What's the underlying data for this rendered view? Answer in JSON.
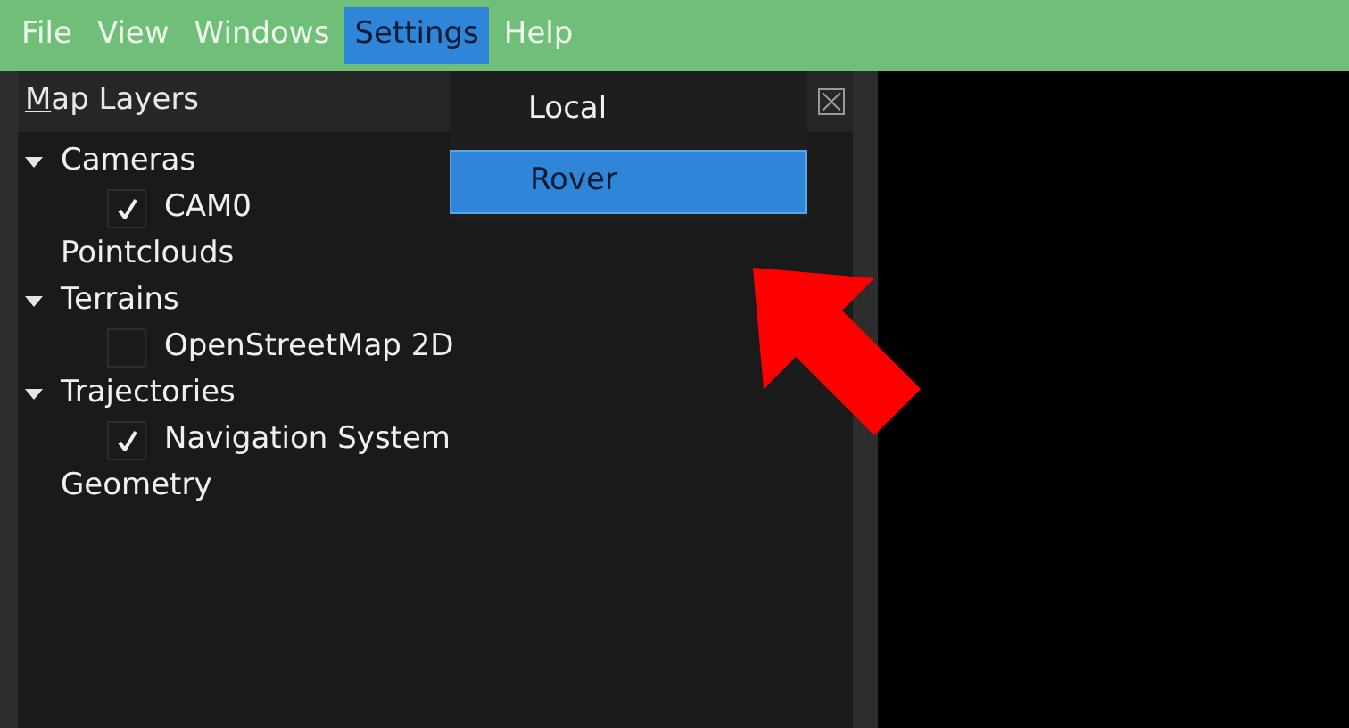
{
  "menu_bar": [
    {
      "label": "File",
      "selected": false
    },
    {
      "label": "View",
      "selected": false
    },
    {
      "label": "Windows",
      "selected": false
    },
    {
      "label": "Settings",
      "selected": true
    },
    {
      "label": "Help",
      "selected": false
    }
  ],
  "dropdown": [
    {
      "label": "Local",
      "selected": false
    },
    {
      "label": "Rover",
      "selected": true
    }
  ],
  "panel": {
    "title_mnemonic": "M",
    "title_rest": "ap Layers"
  },
  "layers": [
    {
      "label": "Cameras",
      "expanded": true,
      "children": [
        {
          "label": "CAM0",
          "checked": true
        }
      ]
    },
    {
      "label": "Pointclouds"
    },
    {
      "label": "Terrains",
      "expanded": true,
      "children": [
        {
          "label": "OpenStreetMap 2D",
          "checked": false
        }
      ]
    },
    {
      "label": "Trajectories",
      "expanded": true,
      "children": [
        {
          "label": "Navigation System",
          "checked": true
        }
      ]
    },
    {
      "label": "Geometry"
    }
  ]
}
